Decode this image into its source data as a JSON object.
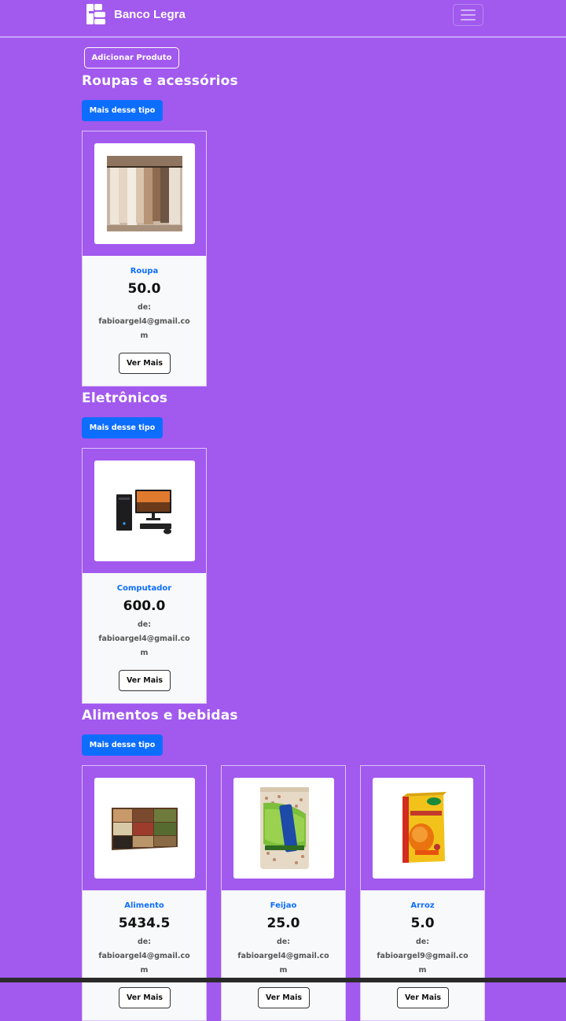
{
  "header": {
    "brand": "Banco Legra",
    "logo_icon": "banco-legra-logo",
    "menu_icon": "hamburger-icon"
  },
  "actions": {
    "add_product": "Adicionar Produto"
  },
  "categories": [
    {
      "title": "Roupas e acessórios",
      "more_label": "Mais desse tipo",
      "products": [
        {
          "name": "Roupa",
          "price": "50.0",
          "by_label": "de:",
          "email": "fabioargel4@gmail.com",
          "button": "Ver Mais",
          "image_icon": "clothes-rack-image"
        }
      ]
    },
    {
      "title": "Eletrônicos",
      "more_label": "Mais desse tipo",
      "products": [
        {
          "name": "Computador",
          "price": "600.0",
          "by_label": "de:",
          "email": "fabioargel4@gmail.com",
          "button": "Ver Mais",
          "image_icon": "desktop-computer-image"
        }
      ]
    },
    {
      "title": "Alimentos e bebidas",
      "more_label": "Mais desse tipo",
      "products": [
        {
          "name": "Alimento",
          "price": "5434.5",
          "by_label": "de:",
          "email": "fabioargel4@gmail.com",
          "button": "Ver Mais",
          "image_icon": "grains-image"
        },
        {
          "name": "Feijao",
          "price": "25.0",
          "by_label": "de:",
          "email": "fabioargel4@gmail.com",
          "button": "Ver Mais",
          "image_icon": "bean-bag-image"
        },
        {
          "name": "Arroz",
          "price": "5.0",
          "by_label": "de:",
          "email": "fabioargel9@gmail.com",
          "button": "Ver Mais",
          "image_icon": "rice-box-image"
        }
      ]
    }
  ],
  "colors": {
    "background": "#a259ee",
    "accent": "#0d6efd",
    "card_body": "#f8f9fa"
  }
}
